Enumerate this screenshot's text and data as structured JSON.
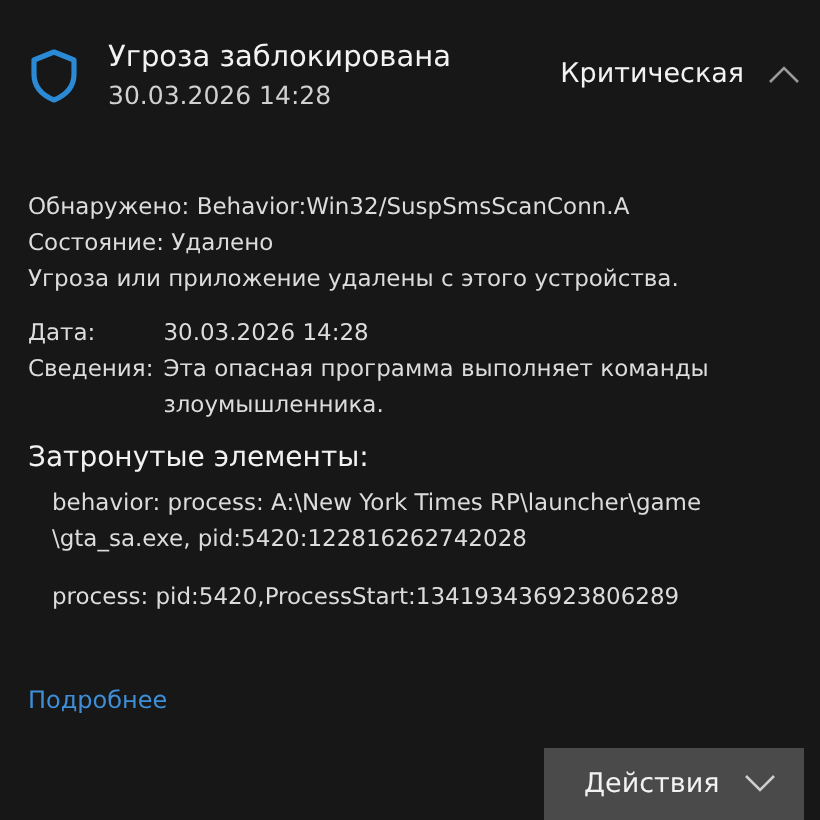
{
  "header": {
    "title": "Угроза заблокирована",
    "timestamp": "30.03.2026 14:28",
    "severity": "Критическая",
    "expanded": true
  },
  "detection": [
    {
      "label": "Обнаружено:",
      "value": "Behavior:Win32/SuspSmsScanConn.A"
    },
    {
      "label": "Состояние:",
      "value": "Удалено"
    }
  ],
  "status_note": "Угроза или приложение удалены с этого устройства.",
  "info": [
    {
      "label": "Дата:",
      "value": "30.03.2026 14:28"
    },
    {
      "label": "Сведения:",
      "value": "Эта опасная программа выполняет команды злоумышленника."
    }
  ],
  "affected": {
    "heading": "Затронутые элементы:",
    "items": [
      "behavior: process: A:\\New York Times RP\\launcher\\game\n\\gta_sa.exe, pid:5420:122816262742028",
      "process: pid:5420,ProcessStart:134193436923806289"
    ]
  },
  "link": "Подробнее",
  "actions_button": "Действия"
}
